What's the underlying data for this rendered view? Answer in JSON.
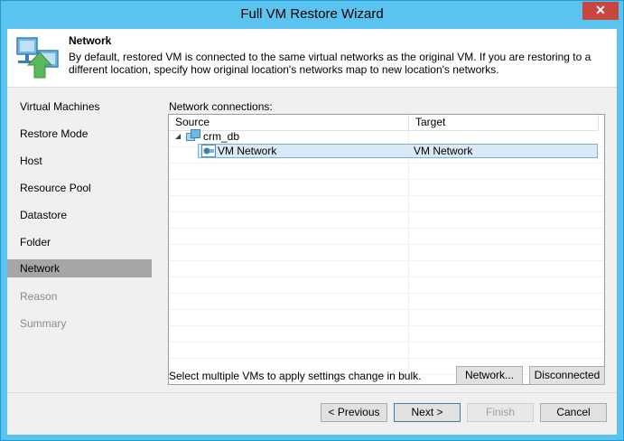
{
  "window": {
    "title": "Full VM Restore Wizard",
    "close_glyph": "✕"
  },
  "header": {
    "title": "Network",
    "description": "By default, restored VM is connected to the same virtual networks as the original VM. If you are restoring to a different location, specify how original location's networks map to new location's networks.",
    "icon": "network-restore-icon"
  },
  "steps": [
    {
      "label": "Virtual Machines",
      "state": "normal"
    },
    {
      "label": "Restore Mode",
      "state": "normal"
    },
    {
      "label": "Host",
      "state": "normal"
    },
    {
      "label": "Resource Pool",
      "state": "normal"
    },
    {
      "label": "Datastore",
      "state": "normal"
    },
    {
      "label": "Folder",
      "state": "normal"
    },
    {
      "label": "Network",
      "state": "active"
    },
    {
      "label": "Reason",
      "state": "disabled"
    },
    {
      "label": "Summary",
      "state": "disabled"
    }
  ],
  "network": {
    "group_label": "Network connections:",
    "columns": {
      "source": "Source",
      "target": "Target"
    },
    "vm": {
      "name": "crm_db",
      "icon": "vm-icon",
      "expanded": true
    },
    "rows": [
      {
        "source": "VM Network",
        "target": "VM Network",
        "selected": true,
        "icon": "network-adapter-icon"
      }
    ],
    "hint": "Select multiple VMs to apply settings change in bulk.",
    "network_button": "Network...",
    "disconnected_button": "Disconnected"
  },
  "footer": {
    "previous": "< Previous",
    "next": "Next >",
    "finish": "Finish",
    "cancel": "Cancel"
  },
  "colors": {
    "titlebar": "#5bc3ef",
    "close": "#c7463f",
    "active_step": "#a6a6a6",
    "selection": "#d9e9f8"
  }
}
